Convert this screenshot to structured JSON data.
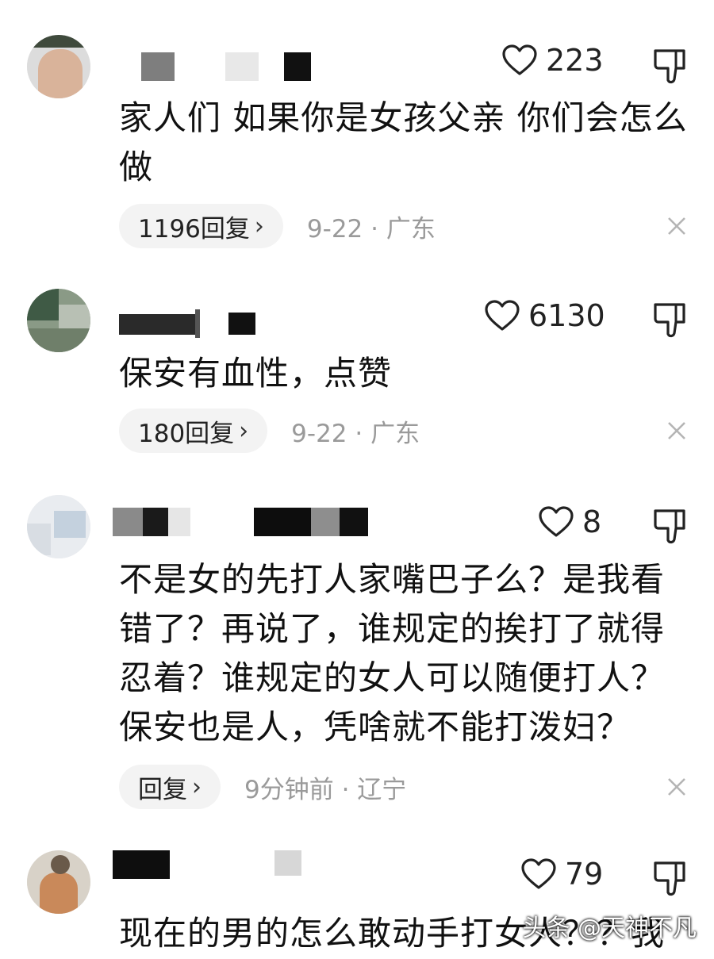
{
  "comments": [
    {
      "likes": "223",
      "text": "家人们 如果你是女孩父亲 你们会怎么做",
      "reply_label": "1196回复",
      "meta": "9-22 · 广东"
    },
    {
      "likes": "6130",
      "text": "保安有血性，点赞",
      "reply_label": "180回复",
      "meta": "9-22 · 广东"
    },
    {
      "likes": "8",
      "text": "不是女的先打人家嘴巴子么？是我看错了？再说了，谁规定的挨打了就得忍着？谁规定的女人可以随便打人？保安也是人，凭啥就不能打泼妇？",
      "reply_label": "回复",
      "meta": "9分钟前 · 辽宁"
    },
    {
      "likes": "79",
      "text": "现在的男的怎么敢动手打女人？？我"
    }
  ],
  "icons": {
    "like": "heart-outline-icon",
    "dislike": "thumbs-down-icon",
    "close": "close-icon",
    "chevron": "chevron-right-icon"
  },
  "watermark": "头条 @天神不凡",
  "colors": {
    "meta_gray": "#9a9a9a",
    "pill_bg": "#f3f3f3"
  }
}
